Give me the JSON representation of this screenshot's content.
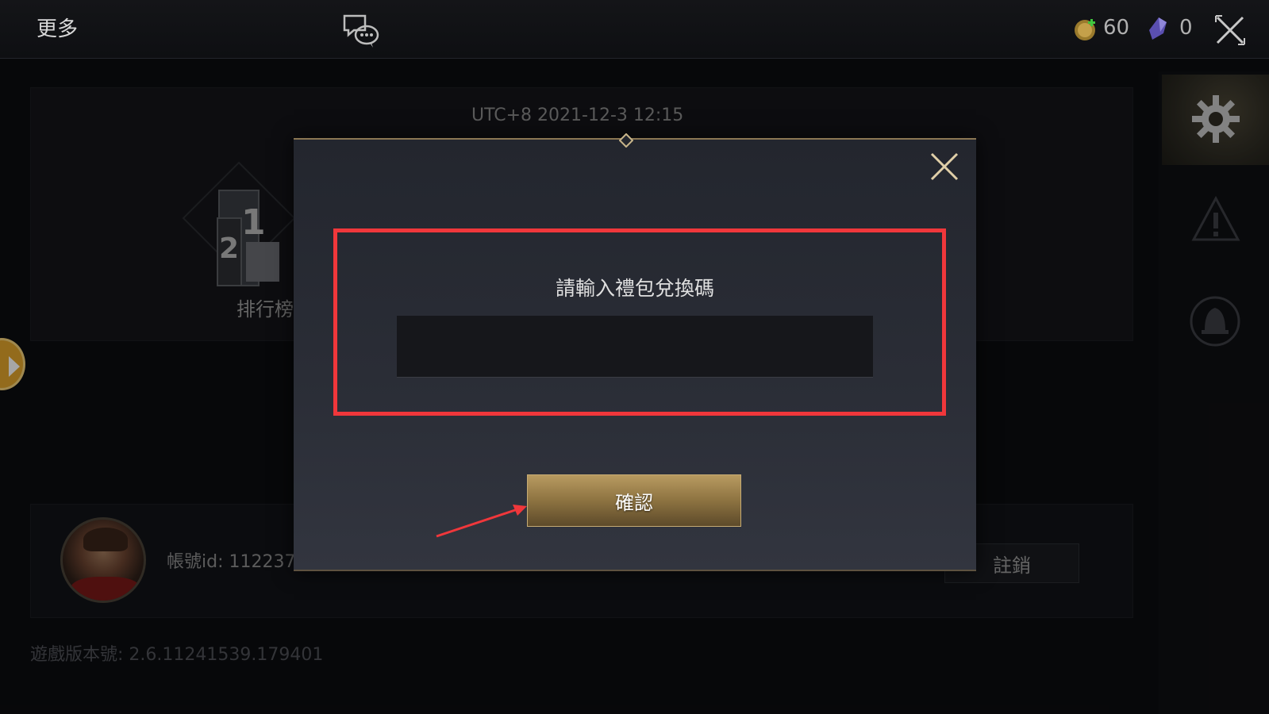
{
  "topbar": {
    "title": "更多",
    "coins": "60",
    "gems": "0"
  },
  "background": {
    "utc_time": "UTC+8 2021-12-3 12:15",
    "rank_label": "排行榜",
    "account_id": "帳號id: 112237",
    "logout_label": "註銷",
    "version": "遊戲版本號: 2.6.11241539.179401"
  },
  "modal": {
    "prompt": "請輸入禮包兌換碼",
    "input_value": "",
    "confirm_label": "確認"
  },
  "colors": {
    "highlight": "#f0373b",
    "gold_accent": "#b89a60"
  },
  "icons": [
    "chat-icon",
    "coin-icon",
    "gem-icon",
    "close-icon",
    "rank-podium-icon",
    "gear-icon",
    "warning-icon",
    "bell-icon",
    "expand-arrow-icon"
  ]
}
